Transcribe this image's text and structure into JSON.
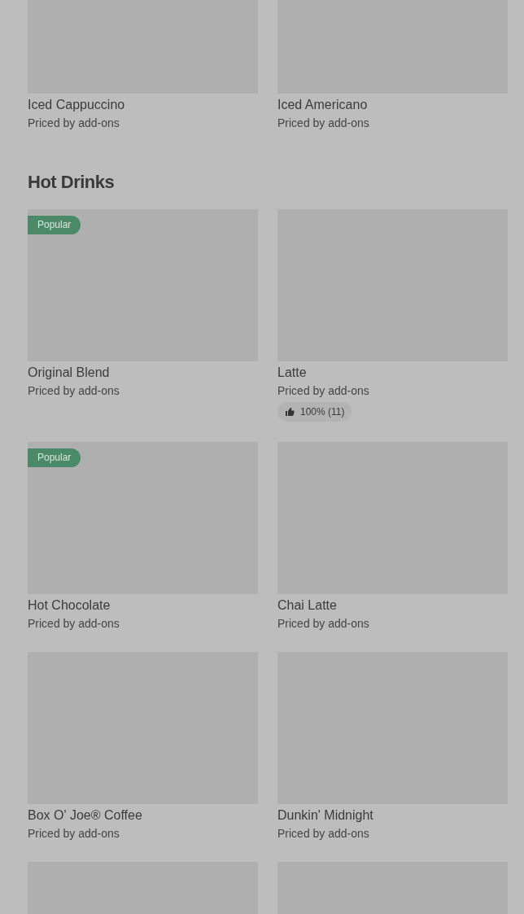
{
  "sections": [
    {
      "items": [
        {
          "name": "Iced Cappuccino",
          "price": "Priced by add-ons"
        },
        {
          "name": "Iced Americano",
          "price": "Priced by add-ons"
        }
      ]
    },
    {
      "title": "Hot Drinks",
      "items": [
        {
          "name": "Original Blend",
          "price": "Priced by add-ons",
          "badge": "Popular"
        },
        {
          "name": "Latte",
          "price": "Priced by add-ons",
          "rating": "100% (11)"
        },
        {
          "name": "Hot Chocolate",
          "price": "Priced by add-ons",
          "badge": "Popular"
        },
        {
          "name": "Chai Latte",
          "price": "Priced by add-ons"
        },
        {
          "name": "Box O' Joe® Coffee",
          "price": "Priced by add-ons"
        },
        {
          "name": "Dunkin' Midnight",
          "price": "Priced by add-ons"
        },
        {
          "partial": true
        },
        {
          "partial": true
        }
      ]
    }
  ]
}
